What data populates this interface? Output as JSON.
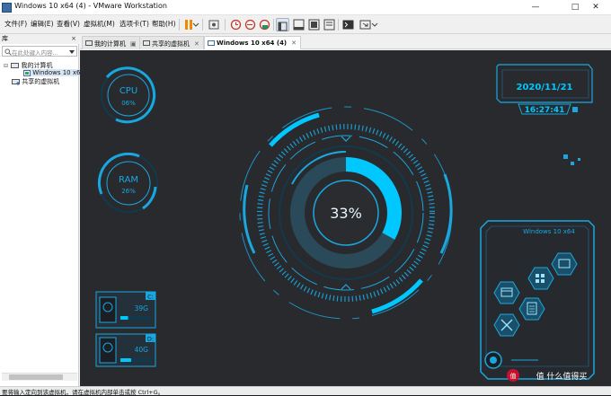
{
  "window": {
    "title": "Windows 10 x64 (4) - VMware Workstation"
  },
  "menu": [
    "文件(F)",
    "编辑(E)",
    "查看(V)",
    "虚拟机(M)",
    "选项卡(T)",
    "帮助(H)"
  ],
  "library": {
    "title": "库",
    "close": "×",
    "search_placeholder": "在此处键入内容...",
    "my_computer": "我的计算机",
    "vm_item": "Windows 10 x64",
    "shared": "共享的虚拟机"
  },
  "tabs": [
    {
      "label": "我的计算机"
    },
    {
      "label": "共享的虚拟机"
    },
    {
      "label": "Windows 10 x64 (4)"
    }
  ],
  "desktop": {
    "cpu": {
      "label": "CPU",
      "value": "06%",
      "fraction": 0.06
    },
    "ram": {
      "label": "RAM",
      "value": "26%",
      "fraction": 0.26
    },
    "center": {
      "value": "33%",
      "fraction": 0.33
    },
    "date": "2020/11/21",
    "time": "16:27:41",
    "drives": [
      {
        "letter": "C:",
        "size": "39G",
        "fraction": 0.25
      },
      {
        "letter": "D:",
        "size": "40G",
        "fraction": 0.35
      }
    ],
    "panel_title": "Windows 10 x64",
    "colors": {
      "accent": "#1aa7e0",
      "bright": "#00c8ff",
      "dark": "#123a4d"
    }
  },
  "status": {
    "text": "要将输入定向到该虚拟机，请在虚拟机内部单击或按 Ctrl+G。"
  },
  "watermark": "值 什么值得买"
}
